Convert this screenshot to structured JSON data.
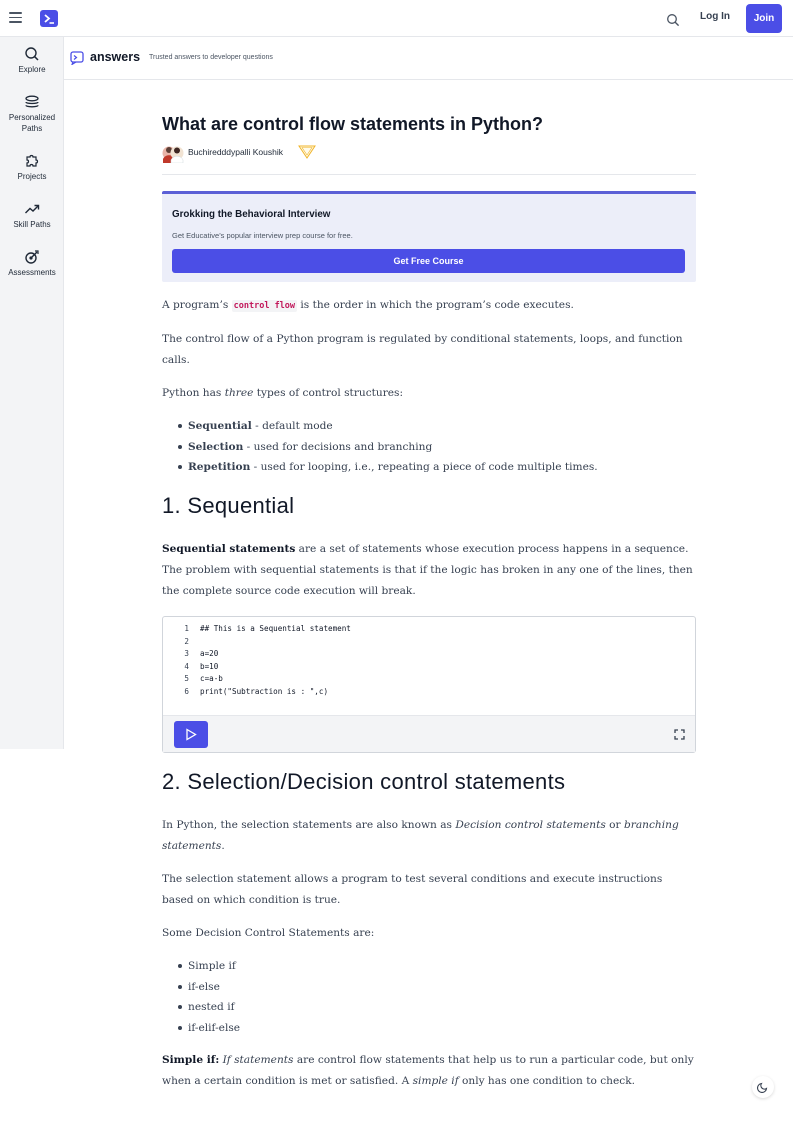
{
  "topbar": {
    "login_label": "Log In",
    "join_label": "Join"
  },
  "sidebar": {
    "items": [
      {
        "label": "Explore",
        "icon": "search-icon"
      },
      {
        "label_line1": "Personalized",
        "label_line2": "Paths",
        "icon": "stack-icon"
      },
      {
        "label": "Projects",
        "icon": "puzzle-icon"
      },
      {
        "label": "Skill Paths",
        "icon": "trending-up-icon"
      },
      {
        "label": "Assessments",
        "icon": "target-icon"
      }
    ]
  },
  "answers_bar": {
    "title": "answers",
    "subtitle": "Trusted answers to developer questions"
  },
  "article": {
    "title": "What are control flow statements in Python?",
    "author": "Buchiredddypalli Koushik",
    "promo": {
      "title": "Grokking the Behavioral Interview",
      "subtitle": "Get Educative’s popular interview prep course for free.",
      "button": "Get Free Course"
    },
    "p1_before": "A program’s ",
    "p1_code": "control flow",
    "p1_after": " is the order in which the program’s code executes.",
    "p2": "The control flow of a Python program is regulated by conditional statements, loops, and function calls.",
    "p3_before": "Python has ",
    "p3_em": "three",
    "p3_after": " types of control structures:",
    "structures": [
      {
        "term": "Sequential",
        "desc": " - default mode"
      },
      {
        "term": "Selection",
        "desc": " - used for decisions and branching"
      },
      {
        "term": "Repetition",
        "desc": " - used for looping, i.e., repeating a piece of code multiple times."
      }
    ],
    "h_sequential": "1. Sequential",
    "seq_term": "Sequential statements",
    "seq_desc": " are a set of statements whose execution process happens in a sequence. The problem with sequential statements is that if the logic has broken in any one of the lines, then the complete source code execution will break.",
    "code": [
      {
        "n": "1",
        "text": "## This is a Sequential statement"
      },
      {
        "n": "2",
        "text": ""
      },
      {
        "n": "3",
        "text": "a=20"
      },
      {
        "n": "4",
        "text": "b=10"
      },
      {
        "n": "5",
        "text": "c=a-b"
      },
      {
        "n": "6",
        "text": "print(\"Subtraction is : \",c)"
      }
    ],
    "h_selection": "2. Selection/Decision control statements",
    "sel_p1_before": "In Python, the selection statements are also known as ",
    "sel_p1_em1": "Decision control statements",
    "sel_p1_mid": " or ",
    "sel_p1_em2": "branching statements",
    "sel_p1_after": ".",
    "sel_p2": "The selection statement allows a program to test several conditions and execute instructions based on which condition is true.",
    "sel_p3": "Some Decision Control Statements are:",
    "decision_list": [
      "Simple if",
      "if-else",
      "nested if",
      "if-elif-else"
    ],
    "simple_if_label": "Simple if:",
    "simple_if_em1": "If statements",
    "simple_if_mid": " are control flow statements that help us to run a particular code, but only when a certain condition is met or satisfied. A ",
    "simple_if_em2": "simple if",
    "simple_if_after": " only has one condition to check."
  },
  "colors": {
    "brand": "#4b4ee6",
    "promo_bg": "#eceef9",
    "inline_code": "#c2185b"
  }
}
